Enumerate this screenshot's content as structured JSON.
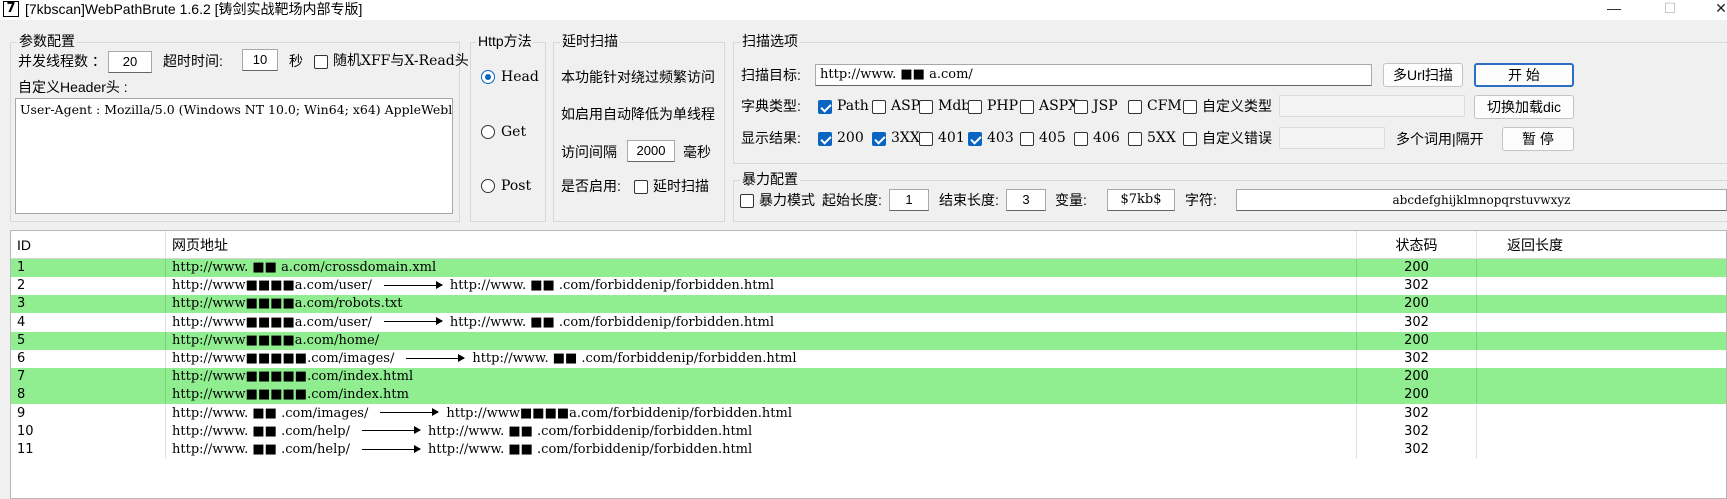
{
  "window": {
    "icon_label": "7",
    "title": "[7kbscan]WebPathBrute 1.6.2 [铸剑实战靶场内部专版]",
    "minimize": "—",
    "maximize": "☐",
    "close": "✕"
  },
  "params": {
    "title": "参数配置",
    "threads_label": "并发线程数 ：",
    "threads_value": "20",
    "timeout_label": "超时时间:",
    "timeout_value": "10",
    "timeout_unit": "秒",
    "xff_label": "随机XFF与X-Read头",
    "header_label": "自定义Header头 :",
    "header_value": "User-Agent : Mozilla/5.0 (Windows NT 10.0; Win64; x64) AppleWebl"
  },
  "http": {
    "title": "Http方法",
    "options": [
      "Head",
      "Get",
      "Post"
    ],
    "selected": "Head"
  },
  "delay": {
    "title": "延时扫描",
    "desc1": "本功能针对绕过频繁访问",
    "desc2": "如启用自动降低为单线程",
    "interval_label": "访问间隔",
    "interval_value": "2000",
    "interval_unit": "毫秒",
    "enable_label": "是否启用:",
    "enable_check_label": "延时扫描"
  },
  "scan": {
    "title": "扫描选项",
    "target_label": "扫描目标:",
    "target_value": "http://www.  ■■  a.com/",
    "multi_url_button": "多Url扫描",
    "start_button": "开 始",
    "dict_label": "字典类型:",
    "dict_types": [
      {
        "label": "Path",
        "checked": true
      },
      {
        "label": "ASP",
        "checked": false
      },
      {
        "label": "Mdb",
        "checked": false
      },
      {
        "label": "PHP",
        "checked": false
      },
      {
        "label": "ASPX",
        "checked": false
      },
      {
        "label": "JSP",
        "checked": false
      },
      {
        "label": "CFM",
        "checked": false
      },
      {
        "label": "自定义类型",
        "checked": false
      }
    ],
    "switch_dict_button": "切换加载dic",
    "show_label": "显示结果:",
    "show_codes": [
      {
        "label": "200",
        "checked": true
      },
      {
        "label": "3XX",
        "checked": true
      },
      {
        "label": "401",
        "checked": false
      },
      {
        "label": "403",
        "checked": true
      },
      {
        "label": "405",
        "checked": false
      },
      {
        "label": "406",
        "checked": false
      },
      {
        "label": "5XX",
        "checked": false
      },
      {
        "label": "自定义错误",
        "checked": false
      }
    ],
    "multi_word_label": "多个词用|隔开",
    "pause_button": "暂 停"
  },
  "brute": {
    "title": "暴力配置",
    "mode_label": "暴力模式",
    "start_len_label": "起始长度:",
    "start_len_value": "1",
    "end_len_label": "结束长度:",
    "end_len_value": "3",
    "var_label": "变量:",
    "var_value": "$7kb$",
    "chars_label": "字符:",
    "chars_value": "abcdefghijklmnopqrstuvwxyz"
  },
  "table": {
    "columns": [
      "ID",
      "网页地址",
      "状态码",
      "返回长度"
    ],
    "rows": [
      {
        "id": "1",
        "url": "http://www.  ■■  a.com/crossdomain.xml",
        "redirect": "",
        "code": "200",
        "length": "",
        "green": true
      },
      {
        "id": "2",
        "url": "http://www■■■■a.com/user/",
        "redirect": "http://www.  ■■  .com/forbiddenip/forbidden.html",
        "code": "302",
        "length": "",
        "green": false
      },
      {
        "id": "3",
        "url": "http://www■■■■a.com/robots.txt",
        "redirect": "",
        "code": "200",
        "length": "",
        "green": true
      },
      {
        "id": "4",
        "url": "http://www■■■■a.com/user/",
        "redirect": "http://www.  ■■  .com/forbiddenip/forbidden.html",
        "code": "302",
        "length": "",
        "green": false
      },
      {
        "id": "5",
        "url": "http://www■■■■a.com/home/",
        "redirect": "",
        "code": "200",
        "length": "",
        "green": true
      },
      {
        "id": "6",
        "url": "http://www■■■■■.com/images/",
        "redirect": "http://www.  ■■  .com/forbiddenip/forbidden.html",
        "code": "302",
        "length": "",
        "green": false
      },
      {
        "id": "7",
        "url": "http://www■■■■■.com/index.html",
        "redirect": "",
        "code": "200",
        "length": "",
        "green": true
      },
      {
        "id": "8",
        "url": "http://www■■■■■.com/index.htm",
        "redirect": "",
        "code": "200",
        "length": "",
        "green": true
      },
      {
        "id": "9",
        "url": "http://www.  ■■  .com/images/",
        "redirect": "http://www■■■■a.com/forbiddenip/forbidden.html",
        "code": "302",
        "length": "",
        "green": false
      },
      {
        "id": "10",
        "url": "http://www.  ■■  .com/help/",
        "redirect": "http://www.  ■■  .com/forbiddenip/forbidden.html",
        "code": "302",
        "length": "",
        "green": false
      },
      {
        "id": "11",
        "url": "http://www.  ■■  .com/help/",
        "redirect": "http://www.  ■■  .com/forbiddenip/forbidden.html",
        "code": "302",
        "length": "",
        "green": false
      }
    ]
  },
  "colors": {
    "row_highlight": "#90ee90",
    "accent": "#0a64c2"
  }
}
